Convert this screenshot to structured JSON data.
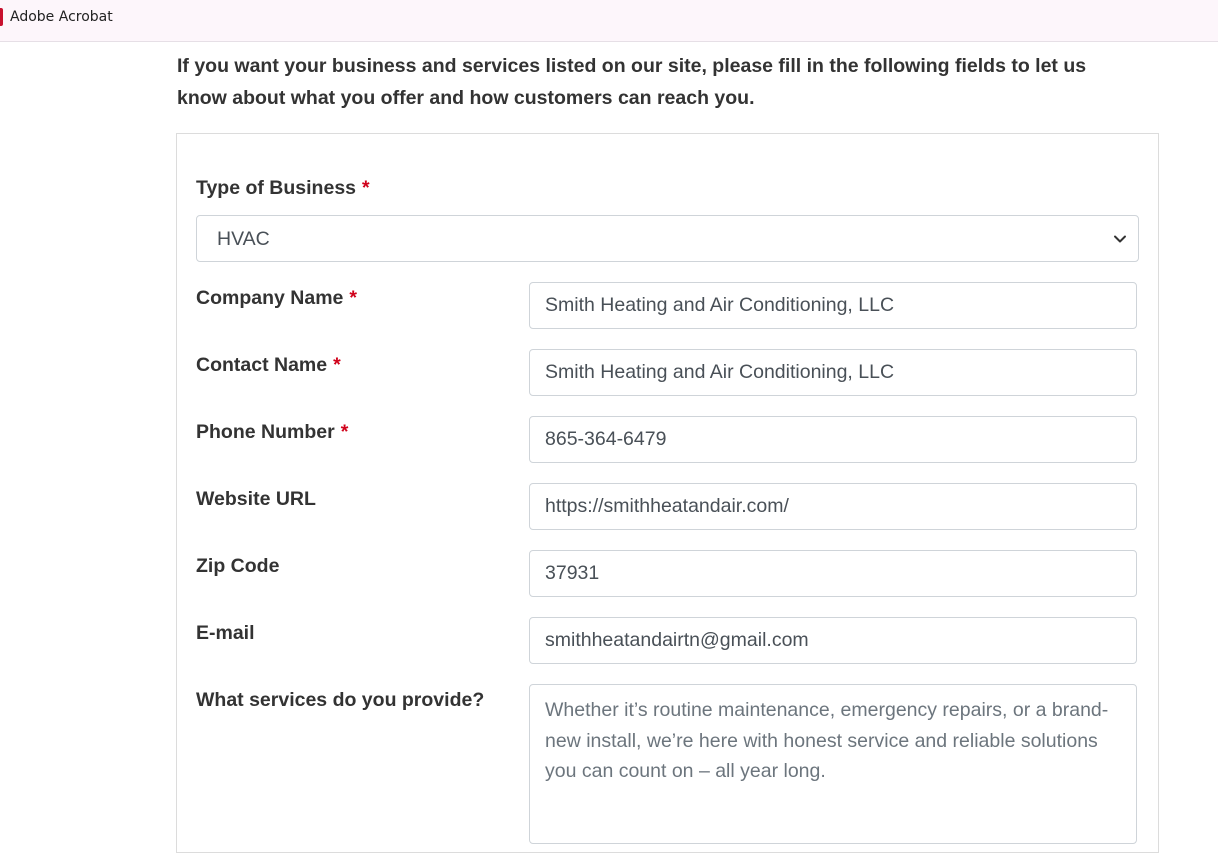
{
  "app": {
    "title": "Adobe Acrobat"
  },
  "intro": "If you want your business and services listed on our site, please fill in the following fields to let us know about what you offer and how customers can reach you.",
  "form": {
    "required_marker": "*",
    "business_type": {
      "label": "Type of Business",
      "value": "HVAC"
    },
    "company_name": {
      "label": "Company Name",
      "value": "Smith Heating and Air Conditioning, LLC"
    },
    "contact_name": {
      "label": "Contact Name",
      "value": "Smith Heating and Air Conditioning, LLC"
    },
    "phone": {
      "label": "Phone Number",
      "value": "865-364-6479"
    },
    "website": {
      "label": "Website URL",
      "value": "https://smithheatandair.com/"
    },
    "zip": {
      "label": "Zip Code",
      "value": "37931"
    },
    "email": {
      "label": "E-mail",
      "value": "smithheatandairtn@gmail.com"
    },
    "services": {
      "label": "What services do you provide?",
      "value": "Whether it’s routine maintenance, emergency repairs, or a brand-new install, we’re here with honest service and reliable solutions you can count on – all year long."
    }
  },
  "colors": {
    "required": "#d0021b",
    "border": "#cfd4d9",
    "topbar": "#fdf6fb"
  },
  "icons": {
    "select_arrow": "chevron-down-icon"
  }
}
